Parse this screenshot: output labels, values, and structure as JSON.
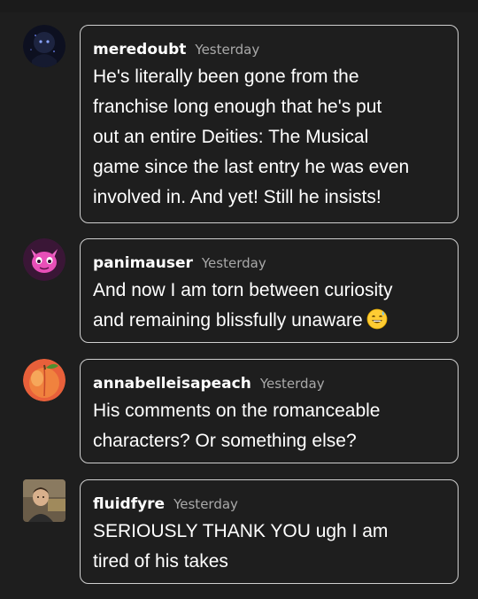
{
  "comments": [
    {
      "username": "meredoubt",
      "timestamp": "Yesterday",
      "text": "He's literally been gone from the\nfranchise long enough that he's put\nout an entire Deities: The Musical\ngame since the last entry he was even\ninvolved in. And yet! Still he insists!",
      "avatar_icon": "dark-figure-avatar"
    },
    {
      "username": "panimauser",
      "timestamp": "Yesterday",
      "text": "And now I am torn between curiosity\nand remaining blissfully unaware",
      "emoji": "grinning-sweat-emoji",
      "avatar_icon": "pink-creature-avatar"
    },
    {
      "username": "annabelleisapeach",
      "timestamp": "Yesterday",
      "text": "His comments on the romanceable\ncharacters? Or something else?",
      "avatar_icon": "peach-avatar"
    },
    {
      "username": "fluidfyre",
      "timestamp": "Yesterday",
      "text": "SERIOUSLY THANK YOU ugh I am\ntired of his takes",
      "avatar_icon": "portrait-photo-avatar"
    }
  ]
}
